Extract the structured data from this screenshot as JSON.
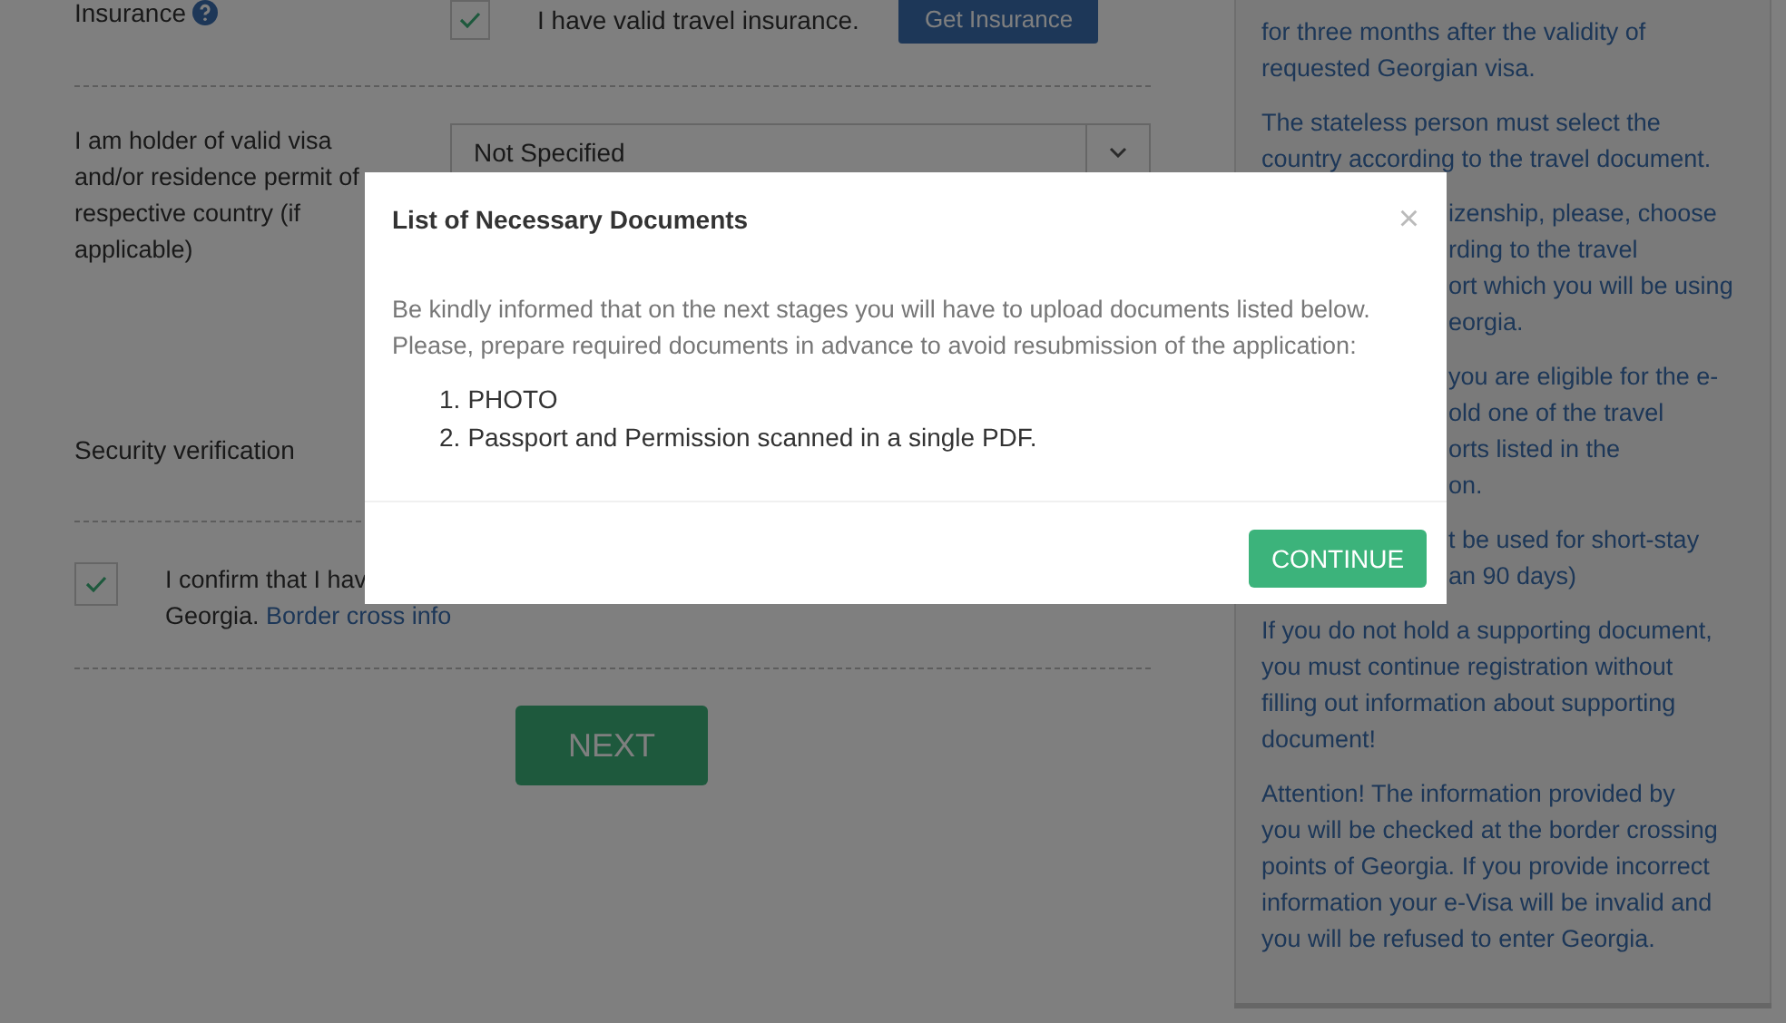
{
  "form": {
    "insurance": {
      "label": "Insurance",
      "checked": true,
      "text": "I have valid travel insurance.",
      "button": "Get Insurance"
    },
    "visa_holder": {
      "label": "I am holder of valid visa and/or residence permit of respective country (if applicable)",
      "value": "Not Specified"
    },
    "security": {
      "label": "Security verification"
    },
    "confirm": {
      "checked": true,
      "text_line_1": "I confirm that I hav",
      "text_line_2": "Georgia.",
      "link": "Border cross info"
    },
    "next_button": "NEXT"
  },
  "sidebar": {
    "paragraphs": [
      {
        "kind": "plain",
        "lines": [
          "for three months after the validity of",
          "requested Georgian visa."
        ]
      },
      {
        "kind": "plain",
        "lines": [
          "The stateless person must select the",
          "country according to the travel document."
        ]
      },
      {
        "kind": "behind_dialog",
        "lines": [
          "izenship, please, choose",
          "rding to the travel",
          "ort which you will be using",
          "eorgia."
        ]
      },
      {
        "kind": "behind_dialog",
        "lines": [
          "you are eligible for the e-",
          "old one of the travel",
          "orts listed in the",
          "on."
        ]
      },
      {
        "kind": "behind_dialog",
        "lines": [
          "t be used for short-stay",
          "an 90 days)"
        ]
      },
      {
        "kind": "plain",
        "lines": [
          "If you do not hold a supporting document,",
          "you must continue registration without",
          "filling out information about supporting",
          "document!"
        ]
      },
      {
        "kind": "plain",
        "lines": [
          "Attention! The information provided by",
          "you will be checked at the border crossing",
          "points of Georgia. If you provide incorrect",
          "information your e-Visa will be invalid and",
          "you will be refused to enter Georgia."
        ]
      }
    ]
  },
  "modal": {
    "title": "List of Necessary Documents",
    "close": "×",
    "intro": "Be kindly informed that on the next stages you will have to upload documents listed below. Please, prepare required documents in advance to avoid resubmission of the application:",
    "documents": [
      {
        "number": "1.",
        "text": "PHOTO"
      },
      {
        "number": "2.",
        "text": "Passport and Permission scanned in a single PDF."
      }
    ],
    "button": "CONTINUE"
  }
}
